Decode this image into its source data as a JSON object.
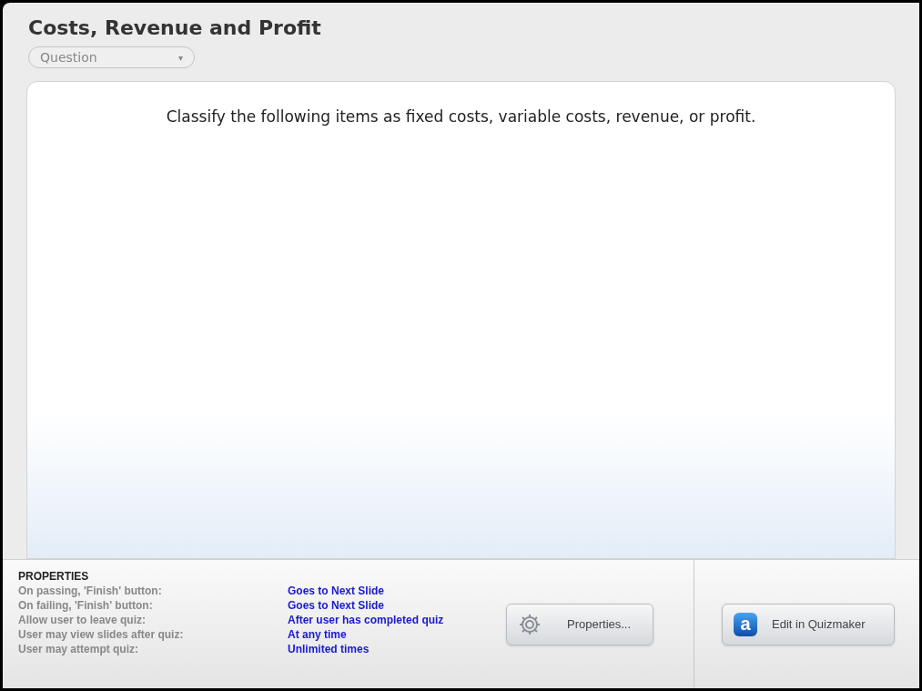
{
  "title": "Costs, Revenue and Profit",
  "slide_type": {
    "value": "Question",
    "caret": "▾"
  },
  "question": "Classify the following items as fixed costs, variable costs, revenue, or profit.",
  "properties": {
    "heading": "PROPERTIES",
    "rows": [
      {
        "label": "On passing, 'Finish' button:",
        "value": "Goes to Next Slide"
      },
      {
        "label": "On failing, 'Finish' button:",
        "value": "Goes to Next Slide"
      },
      {
        "label": "Allow user to leave quiz:",
        "value": "After user has completed quiz"
      },
      {
        "label": "User may view slides after quiz:",
        "value": "At any time"
      },
      {
        "label": "User may attempt quiz:",
        "value": "Unlimited times"
      }
    ]
  },
  "buttons": [
    {
      "kind": "gear",
      "label": "Properties..."
    },
    {
      "kind": "app",
      "label": "Edit in Quizmaker",
      "logo_letter": "a"
    }
  ]
}
